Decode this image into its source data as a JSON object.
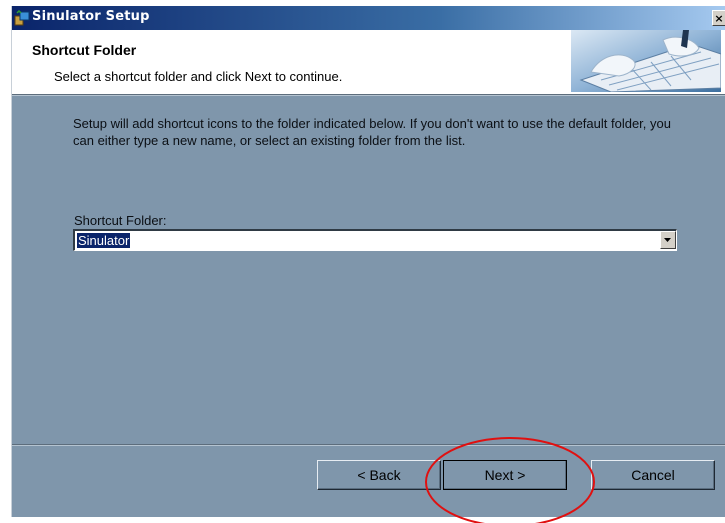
{
  "window": {
    "title": "Sinulator Setup",
    "close_glyph": "×",
    "app_icon": "setup-installer-icon"
  },
  "banner": {
    "title": "Shortcut Folder",
    "subtitle": "Select a shortcut folder and click Next to continue.",
    "graphic": "keyboard-hands-graphic"
  },
  "body": {
    "intro": "Setup will add shortcut icons to the folder indicated below. If you don't want to use the default folder, you can either type a new name, or select an existing folder from the list.",
    "folder_label": "Shortcut Folder:",
    "folder_value": "Sinulator"
  },
  "buttons": {
    "back": "< Back",
    "next": "Next >",
    "cancel": "Cancel"
  },
  "colors": {
    "dialog_bg": "#7f96ab",
    "titlebar_start": "#0a246a",
    "selection": "#0a246a",
    "annotation": "#e01010"
  }
}
